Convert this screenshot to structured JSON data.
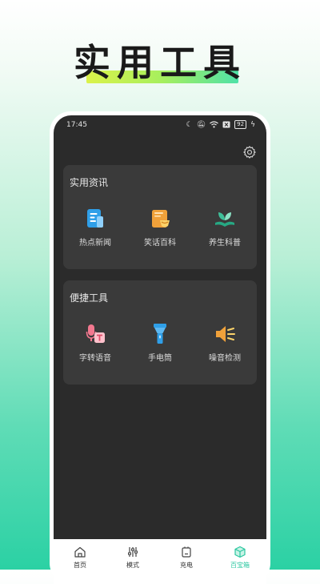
{
  "hero": {
    "title": "实用工具"
  },
  "status_bar": {
    "time": "17:45",
    "battery": "92"
  },
  "sections": [
    {
      "title": "实用资讯",
      "tools": [
        {
          "label": "热点新闻",
          "icon": "news-icon"
        },
        {
          "label": "笑话百科",
          "icon": "joke-book-icon"
        },
        {
          "label": "养生科普",
          "icon": "health-leaf-icon"
        }
      ]
    },
    {
      "title": "便捷工具",
      "tools": [
        {
          "label": "字转语音",
          "icon": "text-to-speech-icon"
        },
        {
          "label": "手电筒",
          "icon": "flashlight-icon"
        },
        {
          "label": "噪音检测",
          "icon": "noise-meter-icon"
        }
      ]
    }
  ],
  "tabbar": {
    "tabs": [
      {
        "label": "首页",
        "icon": "home-icon"
      },
      {
        "label": "模式",
        "icon": "sliders-icon"
      },
      {
        "label": "充电",
        "icon": "battery-charge-icon"
      },
      {
        "label": "百宝箱",
        "icon": "toolbox-icon"
      }
    ],
    "active_index": 3
  },
  "colors": {
    "accent": "#2bc7a0",
    "screen_bg": "#2b2b2b",
    "card_bg": "#3a3a3a"
  }
}
